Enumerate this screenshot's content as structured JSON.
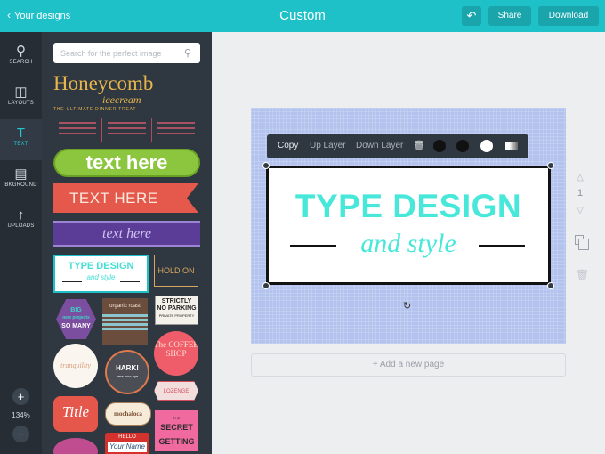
{
  "topbar": {
    "back_label": "Your designs",
    "title": "Custom",
    "undo_icon": "undo-icon",
    "share_label": "Share",
    "download_label": "Download",
    "color": "#1fc1c9"
  },
  "rail": {
    "items": [
      {
        "label": "SEARCH",
        "icon": "search-icon"
      },
      {
        "label": "LAYOUTS",
        "icon": "layouts-icon"
      },
      {
        "label": "TEXT",
        "icon": "text-icon",
        "active": true
      },
      {
        "label": "BKGROUND",
        "icon": "background-icon"
      },
      {
        "label": "UPLOADS",
        "icon": "upload-icon"
      }
    ],
    "zoom_in": "+",
    "zoom_level": "134%",
    "zoom_out": "−"
  },
  "panel": {
    "search_placeholder": "Search for the perfect image",
    "thumbs": {
      "honeycomb_title": "Honeycomb",
      "honeycomb_sub": "icecream",
      "honeycomb_tagline": "THE ULTIMATE DINNER TREAT",
      "green": "text here",
      "red": "TEXT HERE",
      "purple": "text here",
      "type_title": "TYPE DESIGN",
      "type_sub": "and style",
      "holdon": "HOLD ON",
      "big": "BIG",
      "somany": "SO MANY",
      "roast": "organic roast",
      "strictly_1": "STRICTLY",
      "strictly_2": "NO PARKING",
      "strictly_3": "PRIVATE PROPERTY",
      "tranquility": "tranquility",
      "hark": "HARK!",
      "hark_sub": "here your eye",
      "coffee": "The COFFEE SHOP",
      "lozenge": "LOZENGE",
      "title": "Title",
      "mochaloca": "mochaloca",
      "secret_1": "THE",
      "secret_2": "SECRET",
      "secret_3": "GETTING",
      "hello": "HELLO",
      "yourname": "Your Name"
    }
  },
  "canvas": {
    "headline": "TYPE DESIGN",
    "script": "and style",
    "add_page_label": "+ Add a new page",
    "page_number": "1",
    "page_color": "#b4c3ee",
    "text_color": "#47e8da"
  },
  "context_menu": {
    "copy": "Copy",
    "up_layer": "Up Layer",
    "down_layer": "Down Layer",
    "delete_icon": "trash-icon",
    "swatches": [
      "#111111",
      "#111111",
      "#ffffff"
    ]
  }
}
